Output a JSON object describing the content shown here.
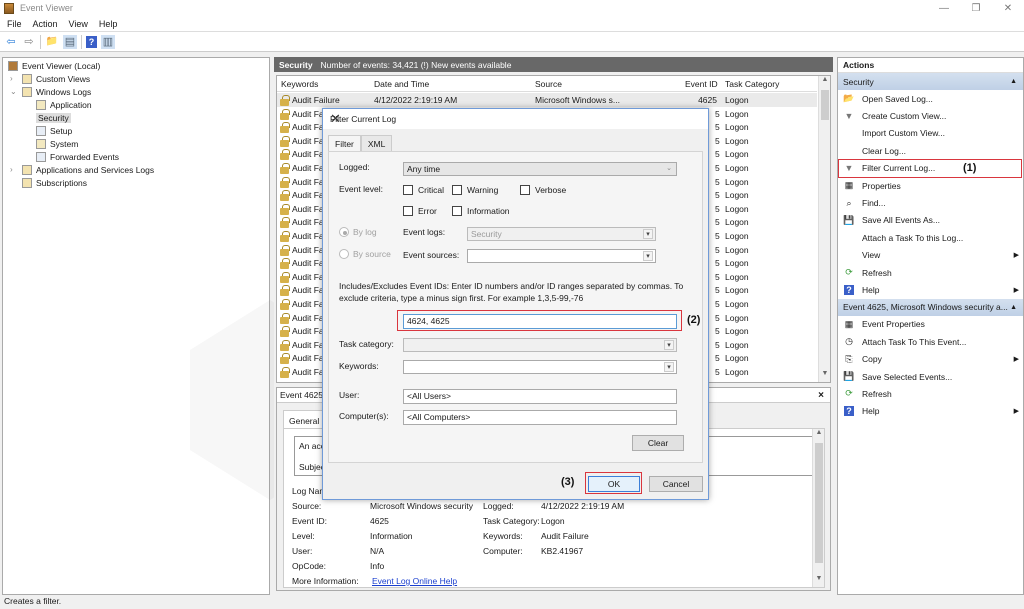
{
  "window": {
    "title": "Event Viewer",
    "controls": {
      "minimize": "—",
      "restore": "❐",
      "close": "✕"
    }
  },
  "menu": [
    "File",
    "Action",
    "View",
    "Help"
  ],
  "toolbar": {
    "icons": [
      "back-icon",
      "forward-icon",
      "up-folder-icon",
      "show-hide-tree-icon",
      "help-icon",
      "show-hide-action-pane-icon"
    ],
    "glyphs": {
      "back": "⇦",
      "forward": "⇨",
      "folder": "📁",
      "tree": "▤",
      "help": "?",
      "pane": "▥"
    }
  },
  "tree": {
    "root": "Event Viewer (Local)",
    "items": [
      {
        "label": "Custom Views",
        "level": 1,
        "expander": "›"
      },
      {
        "label": "Windows Logs",
        "level": 1,
        "expander": "⌄"
      },
      {
        "label": "Application",
        "level": 2
      },
      {
        "label": "Security",
        "level": 2,
        "selected": true
      },
      {
        "label": "Setup",
        "level": 2
      },
      {
        "label": "System",
        "level": 2
      },
      {
        "label": "Forwarded Events",
        "level": 2
      },
      {
        "label": "Applications and Services Logs",
        "level": 1,
        "expander": "›"
      },
      {
        "label": "Subscriptions",
        "level": 1
      }
    ]
  },
  "log": {
    "name": "Security",
    "summary": "Number of events: 34,421 (!) New events available",
    "columns": [
      "Keywords",
      "Date and Time",
      "Source",
      "Event ID",
      "Task Category"
    ],
    "first_row": {
      "keywords": "Audit Failure",
      "date": "4/12/2022 2:19:19 AM",
      "source": "Microsoft Windows s...",
      "event_id": "4625",
      "task": "Logon"
    },
    "row_keyword_truncated": "Audit Fa",
    "row_id_truncated": "5",
    "row_task": "Logon",
    "visible_rows": 21
  },
  "detail": {
    "header": "Event 4625,",
    "close": "×",
    "tab": "General",
    "message_lines": [
      "An acco",
      "Subject:"
    ],
    "fields": {
      "log_name_label": "Log Nam",
      "source_label": "Source:",
      "source_value": "Microsoft Windows security",
      "logged_label": "Logged:",
      "logged_value": "4/12/2022 2:19:19 AM",
      "event_id_label": "Event ID:",
      "event_id_value": "4625",
      "task_category_label": "Task Category:",
      "task_category_value": "Logon",
      "level_label": "Level:",
      "level_value": "Information",
      "keywords_label": "Keywords:",
      "keywords_value": "Audit Failure",
      "user_label": "User:",
      "user_value": "N/A",
      "computer_label": "Computer:",
      "computer_value": "KB2.41967",
      "opcode_label": "OpCode:",
      "opcode_value": "Info",
      "more_info_label": "More Information:",
      "more_info_link": "Event Log Online Help"
    }
  },
  "actions": {
    "title": "Actions",
    "sections": [
      {
        "title": "Security",
        "items": [
          {
            "label": "Open Saved Log...",
            "icon": "📂"
          },
          {
            "label": "Create Custom View...",
            "icon": "▼"
          },
          {
            "label": "Import Custom View...",
            "icon": ""
          },
          {
            "label": "Clear Log...",
            "icon": ""
          },
          {
            "label": "Filter Current Log...",
            "icon": "▼"
          },
          {
            "label": "Properties",
            "icon": "▦"
          },
          {
            "label": "Find...",
            "icon": "⌕"
          },
          {
            "label": "Save All Events As...",
            "icon": "💾"
          },
          {
            "label": "Attach a Task To this Log...",
            "icon": ""
          },
          {
            "label": "View",
            "icon": "",
            "submenu": true
          },
          {
            "label": "Refresh",
            "icon": "⟳"
          },
          {
            "label": "Help",
            "icon": "?",
            "submenu": true
          }
        ]
      },
      {
        "title": "Event 4625, Microsoft Windows security a...",
        "items": [
          {
            "label": "Event Properties",
            "icon": "▦"
          },
          {
            "label": "Attach Task To This Event...",
            "icon": "◷"
          },
          {
            "label": "Copy",
            "icon": "⎘",
            "submenu": true
          },
          {
            "label": "Save Selected Events...",
            "icon": "💾"
          },
          {
            "label": "Refresh",
            "icon": "⟳"
          },
          {
            "label": "Help",
            "icon": "?",
            "submenu": true
          }
        ]
      }
    ],
    "submenu_arrow": "▶",
    "collapse_arrow": "▲"
  },
  "dialog": {
    "title": "Filter Current Log",
    "close": "✕",
    "tabs": [
      "Filter",
      "XML"
    ],
    "logged_label": "Logged:",
    "logged_value": "Any time",
    "event_level_label": "Event level:",
    "levels": [
      "Critical",
      "Warning",
      "Verbose",
      "Error",
      "Information"
    ],
    "by_log_label": "By log",
    "by_source_label": "By source",
    "event_logs_label": "Event logs:",
    "event_logs_value": "Security",
    "event_sources_label": "Event sources:",
    "event_sources_value": "",
    "help_text": "Includes/Excludes Event IDs: Enter ID numbers and/or ID ranges separated by commas. To exclude criteria, type a minus sign first. For example 1,3,5-99,-76",
    "event_ids_value": "4624, 4625",
    "task_category_label": "Task category:",
    "keywords_label": "Keywords:",
    "user_label": "User:",
    "user_value": "<All Users>",
    "computers_label": "Computer(s):",
    "computers_value": "<All Computers>",
    "clear_label": "Clear",
    "ok_label": "OK",
    "cancel_label": "Cancel",
    "dropdown_glyph": "⌄",
    "dropdown_glyph2": "▾"
  },
  "annotations": {
    "step1": "(1)",
    "step2": "(2)",
    "step3": "(3)",
    "color": "#d9363e"
  },
  "status": "Creates a filter."
}
